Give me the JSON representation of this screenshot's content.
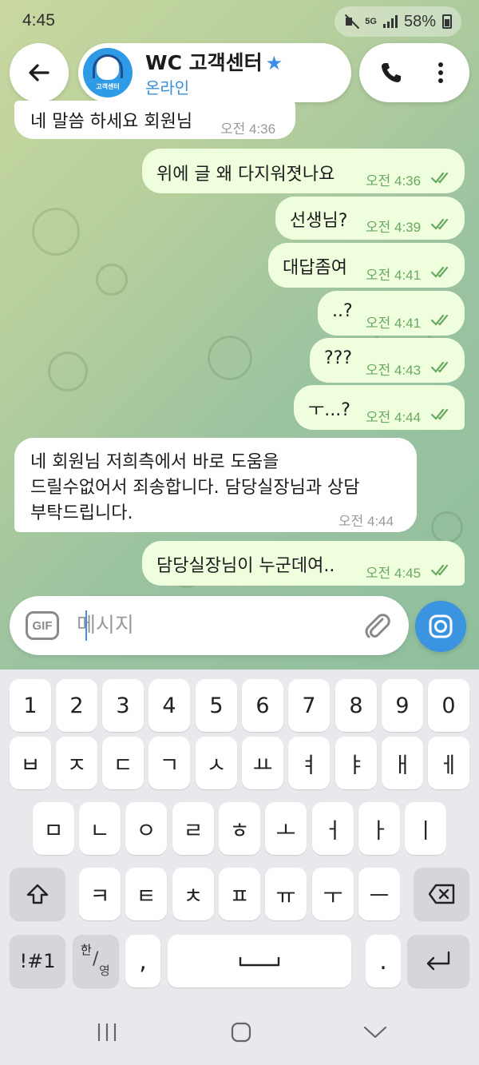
{
  "status_bar": {
    "time": "4:45",
    "network": "5G",
    "battery": "58%"
  },
  "header": {
    "contact_name": "WC 고객센터",
    "contact_status": "온라인",
    "avatar_text": "고객센터"
  },
  "messages": [
    {
      "direction": "in",
      "text": "네 말씀 하세요 회원님",
      "time": "오전 4:36"
    },
    {
      "direction": "out",
      "text": "위에 글 왜 다지워졋나요",
      "time": "오전 4:36",
      "read": true
    },
    {
      "direction": "out",
      "text": "선생님?",
      "time": "오전 4:39",
      "read": true
    },
    {
      "direction": "out",
      "text": "대답좀여",
      "time": "오전 4:41",
      "read": true
    },
    {
      "direction": "out",
      "text": "..?",
      "time": "오전 4:41",
      "read": true
    },
    {
      "direction": "out",
      "text": "???",
      "time": "오전 4:43",
      "read": true
    },
    {
      "direction": "out",
      "text": "ㅜ...?",
      "time": "오전 4:44",
      "read": true
    },
    {
      "direction": "in",
      "text_lines": [
        "네 회원님 저희측에서 바로 도움을",
        "드릴수없어서 죄송합니다. 담당실장님과 상담",
        "부탁드립니다."
      ],
      "time": "오전 4:44"
    },
    {
      "direction": "out",
      "text": "담당실장님이 누군데여..",
      "time": "오전 4:45",
      "read": true
    }
  ],
  "composer": {
    "gif_label": "GIF",
    "placeholder": "메시지"
  },
  "keyboard": {
    "row1": [
      "1",
      "2",
      "3",
      "4",
      "5",
      "6",
      "7",
      "8",
      "9",
      "0"
    ],
    "row2": [
      "ㅂ",
      "ㅈ",
      "ㄷ",
      "ㄱ",
      "ㅅ",
      "ㅛ",
      "ㅕ",
      "ㅑ",
      "ㅐ",
      "ㅔ"
    ],
    "row3": [
      "ㅁ",
      "ㄴ",
      "ㅇ",
      "ㄹ",
      "ㅎ",
      "ㅗ",
      "ㅓ",
      "ㅏ",
      "ㅣ"
    ],
    "row4": [
      "ㅋ",
      "ㅌ",
      "ㅊ",
      "ㅍ",
      "ㅠ",
      "ㅜ",
      "ㅡ"
    ],
    "symbols_label": "!#1",
    "lang_top": "한",
    "lang_bottom": "영",
    "comma": ",",
    "period": "."
  },
  "colors": {
    "accent": "#3a94e0",
    "outgoing_bubble": "#effedd",
    "incoming_bubble": "#ffffff",
    "read_tick": "#6aa962"
  }
}
